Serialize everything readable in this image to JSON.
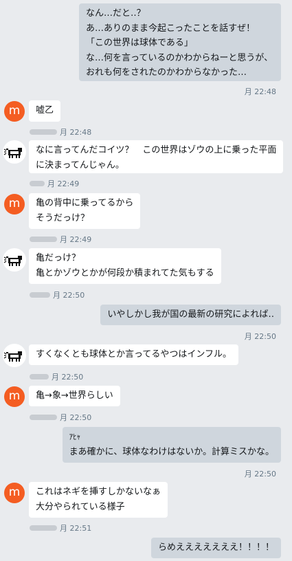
{
  "avatar_letter": "m",
  "colors": {
    "background": "#e9ebee",
    "incoming_bubble": "#ffffff",
    "outgoing_bubble": "#cfd6dd",
    "avatar_orange": "#f45d22"
  },
  "messages": [
    {
      "lines": [
        "なん…だと‥？",
        "あ…ありのまま今起こったことを話すぜ！",
        "「この世界は球体である」",
        "な…何を言っているのかわからねーと思うが、",
        "おれも何をされたのかわからなかった…"
      ],
      "time": "月 22:48"
    },
    {
      "lines": [
        "嘘乙"
      ],
      "time": "月 22:48"
    },
    {
      "lines": [
        "なに言ってんだコイツ？　この世界はゾウの上に乗った平面",
        "に決まってんじゃん。"
      ],
      "time": "月 22:49"
    },
    {
      "lines": [
        "亀の背中に乗ってるから",
        "そうだっけ？"
      ],
      "time": "月 22:49"
    },
    {
      "lines": [
        "亀だっけ？",
        "亀とかゾウとかが何段か積まれてた気もする"
      ],
      "time": "月 22:50"
    },
    {
      "lines": [
        "いやしかし我が国の最新の研究によれば‥"
      ],
      "time": "月 22:50"
    },
    {
      "lines": [
        "すくなくとも球体とか言ってるやつはインフル。"
      ],
      "time": "月 22:50"
    },
    {
      "lines": [
        "亀→象→世界らしい"
      ],
      "time": "月 22:50"
    },
    {
      "lines": [
        "ｱﾋｬ",
        "まあ確かに、球体なわけはないか。計算ミスかな。"
      ],
      "time": "月 22:50"
    },
    {
      "lines": [
        "これはネギを挿すしかないなぁ",
        "大分やられている様子"
      ],
      "time": "月 22:51"
    },
    {
      "lines": [
        "らめえええええええ！！！！"
      ]
    }
  ]
}
